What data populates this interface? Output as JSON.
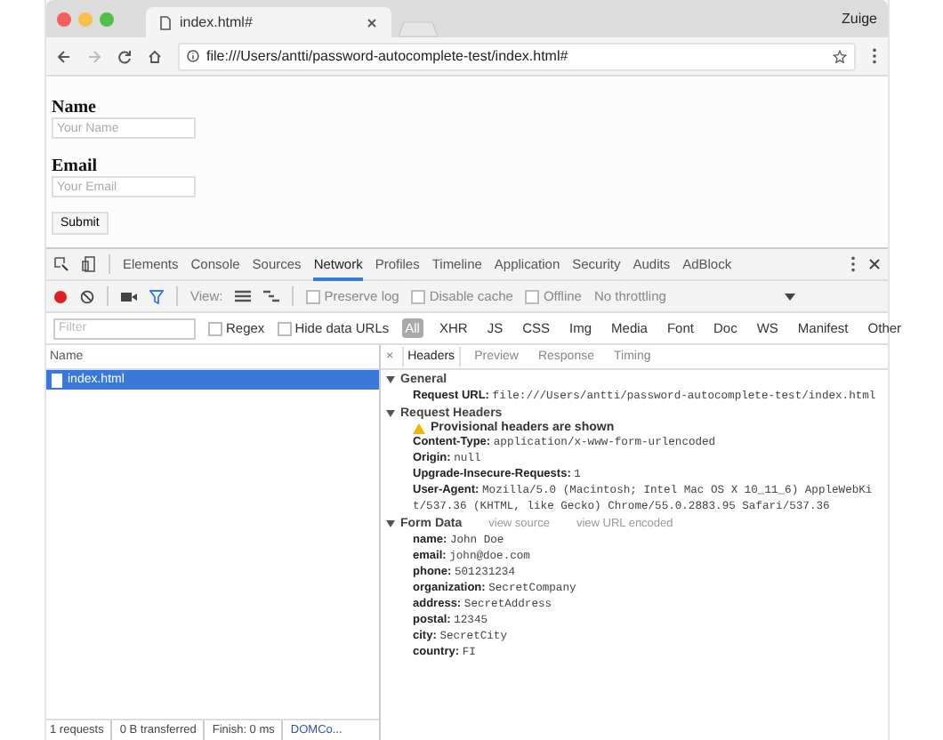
{
  "window": {
    "tab_title": "index.html#",
    "profile": "Zuige",
    "url": "file:///Users/antti/password-autocomplete-test/index.html#"
  },
  "page": {
    "fields": [
      {
        "label": "Name",
        "placeholder": "Your Name"
      },
      {
        "label": "Email",
        "placeholder": "Your Email"
      }
    ],
    "submit": "Submit"
  },
  "devtools": {
    "tabs": [
      {
        "label": "Elements",
        "selected": false
      },
      {
        "label": "Console",
        "selected": false
      },
      {
        "label": "Sources",
        "selected": false
      },
      {
        "label": "Network",
        "selected": true
      },
      {
        "label": "Profiles",
        "selected": false
      },
      {
        "label": "Timeline",
        "selected": false
      },
      {
        "label": "Application",
        "selected": false
      },
      {
        "label": "Security",
        "selected": false
      },
      {
        "label": "Audits",
        "selected": false
      },
      {
        "label": "AdBlock",
        "selected": false
      }
    ],
    "toolbar": {
      "recording": true,
      "view_label": "View:",
      "checkboxes": [
        {
          "label": "Preserve log",
          "checked": false
        },
        {
          "label": "Disable cache",
          "checked": false
        },
        {
          "label": "Offline",
          "checked": false
        }
      ],
      "throttle": "No throttling"
    },
    "filter": {
      "placeholder": "Filter",
      "checkboxes": [
        {
          "label": "Regex",
          "checked": false
        },
        {
          "label": "Hide data URLs",
          "checked": false
        }
      ],
      "types": [
        {
          "label": "All",
          "selected": true
        },
        {
          "label": "XHR",
          "selected": false
        },
        {
          "label": "JS",
          "selected": false
        },
        {
          "label": "CSS",
          "selected": false
        },
        {
          "label": "Img",
          "selected": false
        },
        {
          "label": "Media",
          "selected": false
        },
        {
          "label": "Font",
          "selected": false
        },
        {
          "label": "Doc",
          "selected": false
        },
        {
          "label": "WS",
          "selected": false
        },
        {
          "label": "Manifest",
          "selected": false
        },
        {
          "label": "Other",
          "selected": false
        }
      ]
    },
    "requests": {
      "column": "Name",
      "rows": [
        {
          "name": "index.html",
          "selected": true
        }
      ]
    },
    "status": [
      "1 requests",
      "0 B transferred",
      "Finish: 0 ms",
      "DOMCo..."
    ],
    "details": {
      "close": "×",
      "tabs": [
        {
          "label": "Headers",
          "selected": true
        },
        {
          "label": "Preview",
          "selected": false
        },
        {
          "label": "Response",
          "selected": false
        },
        {
          "label": "Timing",
          "selected": false
        }
      ],
      "sections": [
        {
          "title": "General",
          "expanded": true,
          "items": [
            {
              "key": "Request URL:",
              "value": "file:///Users/antti/password-autocomplete-test/index.html"
            }
          ]
        },
        {
          "title": "Request Headers",
          "expanded": true,
          "warning": "Provisional headers are shown",
          "items": [
            {
              "key": "Content-Type:",
              "value": "application/x-www-form-urlencoded"
            },
            {
              "key": "Origin:",
              "value": "null"
            },
            {
              "key": "Upgrade-Insecure-Requests:",
              "value": "1"
            },
            {
              "key": "User-Agent:",
              "value": "Mozilla/5.0 (Macintosh; Intel Mac OS X 10_11_6) AppleWebKit/537.36 (KHTML, like Gecko) Chrome/55.0.2883.95 Safari/537.36"
            }
          ]
        },
        {
          "title": "Form Data",
          "expanded": true,
          "links": [
            "view source",
            "view URL encoded"
          ],
          "items": [
            {
              "key": "name:",
              "value": "John Doe"
            },
            {
              "key": "email:",
              "value": "john@doe.com"
            },
            {
              "key": "phone:",
              "value": "501231234"
            },
            {
              "key": "organization:",
              "value": "SecretCompany"
            },
            {
              "key": "address:",
              "value": "SecretAddress"
            },
            {
              "key": "postal:",
              "value": "12345"
            },
            {
              "key": "city:",
              "value": "SecretCity"
            },
            {
              "key": "country:",
              "value": "FI"
            }
          ]
        }
      ]
    }
  }
}
